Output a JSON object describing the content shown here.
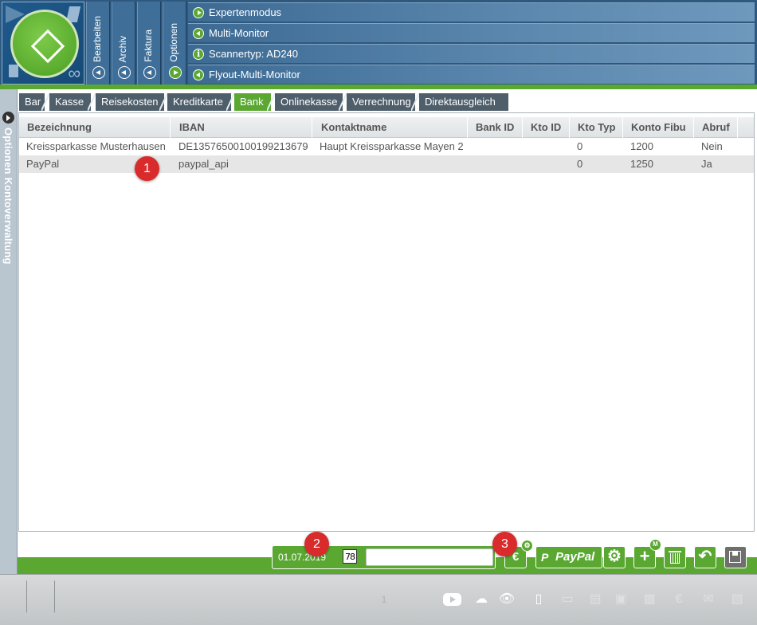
{
  "ribbon": {
    "vertical_tabs": [
      {
        "label": "Bearbeiten"
      },
      {
        "label": "Archiv"
      },
      {
        "label": "Faktura"
      },
      {
        "label": "Optionen"
      }
    ],
    "flyout_items": [
      {
        "label": "Expertenmodus",
        "icon": "play-right-icon"
      },
      {
        "label": "Multi-Monitor",
        "icon": "play-left-icon"
      },
      {
        "label": "Scannertyp: AD240",
        "icon": "info-icon"
      },
      {
        "label": "Flyout-Multi-Monitor",
        "icon": "play-left-icon"
      }
    ],
    "logo_symbol": "∞"
  },
  "side_panel": {
    "label": "Optionen  Kontoverwaltung"
  },
  "tabs": [
    {
      "label": "Bar",
      "active": false
    },
    {
      "label": "Kasse",
      "active": false
    },
    {
      "label": "Reisekosten",
      "active": false
    },
    {
      "label": "Kreditkarte",
      "active": false
    },
    {
      "label": "Bank",
      "active": true
    },
    {
      "label": "Onlinekasse",
      "active": false
    },
    {
      "label": "Verrechnung",
      "active": false
    },
    {
      "label": "Direktausgleich",
      "active": false
    }
  ],
  "table": {
    "columns": [
      "Bezeichnung",
      "IBAN",
      "Kontaktname",
      "Bank ID",
      "Kto ID",
      "Kto Typ",
      "Konto Fibu",
      "Abruf"
    ],
    "rows": [
      [
        "Kreissparkasse Musterhausen",
        "DE13576500100199213679",
        "Haupt Kreissparkasse Mayen 2",
        "",
        "",
        "0",
        "1200",
        "Nein"
      ],
      [
        "PayPal",
        "paypal_api",
        "",
        "",
        "",
        "0",
        "1250",
        "Ja"
      ]
    ]
  },
  "toolbar": {
    "date": "01.07.2019",
    "calendar_label": "78",
    "search_value": "",
    "euro_label": "€",
    "paypal_label": "PayPal",
    "paypal_logo": "P",
    "gear_label": "⚙",
    "add_label": "+",
    "add_badge": "M",
    "undo_label": "↶"
  },
  "badges": [
    "1",
    "2",
    "3"
  ],
  "footer": {
    "icons": [
      "youtube-icon",
      "cloud-upload-icon",
      "eye-icon",
      "scanner-icon",
      "tablet-icon",
      "document-icon",
      "save-icon",
      "grid-icon",
      "euro-icon",
      "mail-icon",
      "image-icon"
    ],
    "page_marker": "1"
  },
  "colors": {
    "accent_green": "#5aa832",
    "ribbon_blue": "#2e587e",
    "badge_red": "#d92b2b"
  }
}
